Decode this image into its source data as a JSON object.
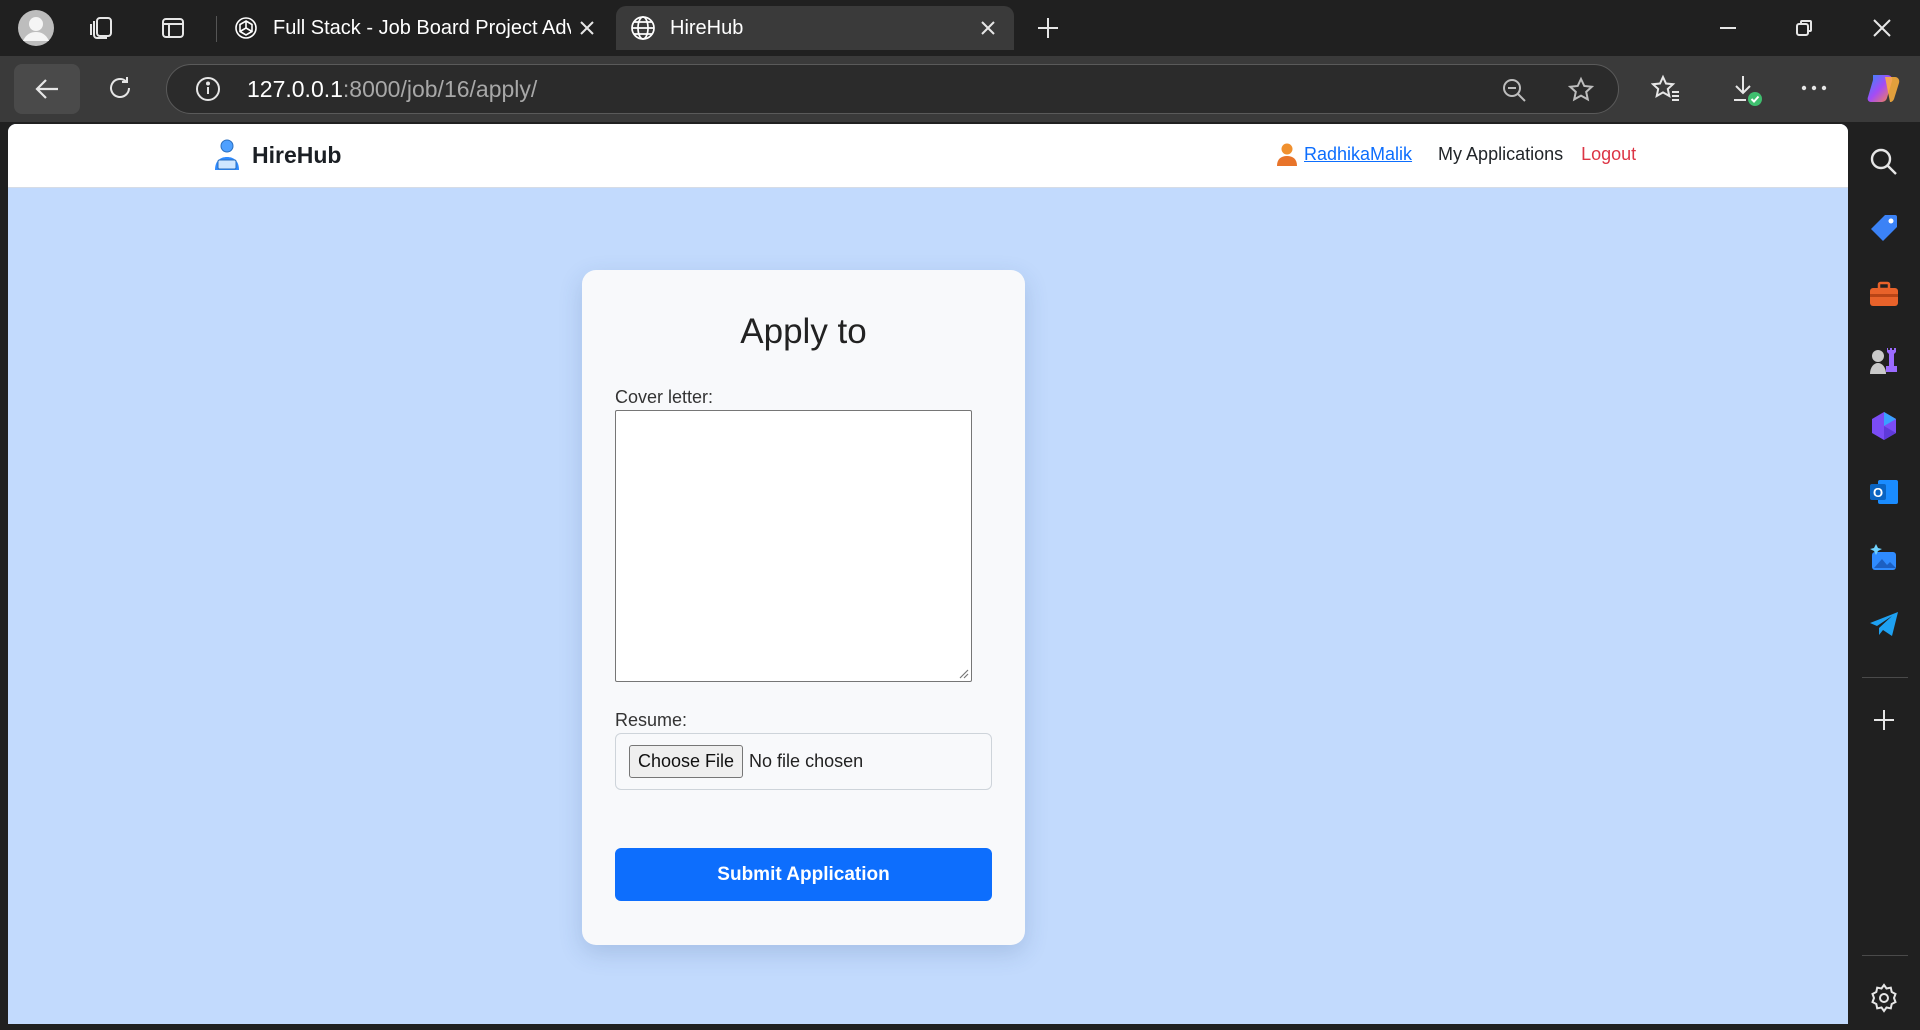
{
  "browser": {
    "tabs": [
      {
        "title": "Full Stack - Job Board Project Adv",
        "favicon": "chatgpt-icon"
      },
      {
        "title": "HireHub",
        "favicon": "globe-icon"
      }
    ],
    "address": {
      "host": "127.0.0.1",
      "path": ":8000/job/16/apply/"
    }
  },
  "sidebar_icons": [
    "search-icon",
    "shopping-tag-icon",
    "toolbox-icon",
    "games-icon",
    "copilot-icon",
    "outlook-icon",
    "drop-icon",
    "telegram-icon",
    "add-icon",
    "settings-icon"
  ],
  "navbar": {
    "brand": "HireHub",
    "username": "RadhikaMalik",
    "my_applications": "My Applications",
    "logout": "Logout"
  },
  "form": {
    "title": "Apply to",
    "cover_letter_label": "Cover letter:",
    "cover_letter_value": "",
    "resume_label": "Resume:",
    "choose_file": "Choose File",
    "file_status": "No file chosen",
    "submit": "Submit Application"
  },
  "colors": {
    "page_bg": "#c2dafd",
    "primary": "#0d6efd",
    "logout": "#dc3545"
  }
}
